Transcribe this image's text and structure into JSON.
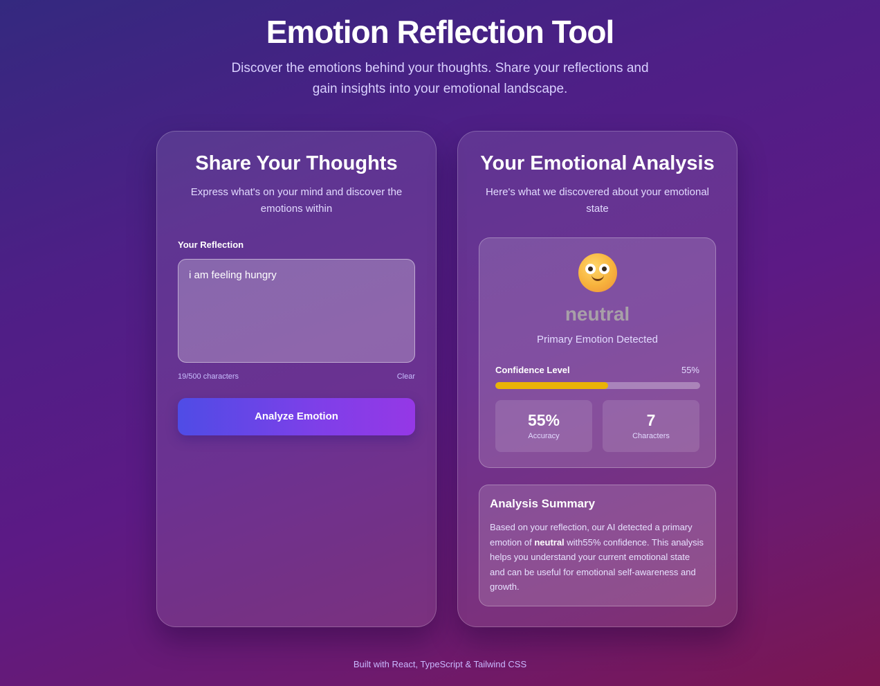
{
  "header": {
    "title": "Emotion Reflection Tool",
    "subtitle": "Discover the emotions behind your thoughts. Share your reflections and gain insights into your emotional landscape."
  },
  "input_card": {
    "title": "Share Your Thoughts",
    "subtitle": "Express what's on your mind and discover the emotions within",
    "field_label": "Your Reflection",
    "textarea_value": "i am feeling hungry",
    "char_counter": "19/500 characters",
    "clear_label": "Clear",
    "analyze_label": "Analyze Emotion"
  },
  "result_card": {
    "title": "Your Emotional Analysis",
    "subtitle": "Here's what we discovered about your emotional state",
    "emoji_icon": "neutral-face-icon",
    "emotion": "neutral",
    "emotion_caption": "Primary Emotion Detected",
    "confidence_label": "Confidence Level",
    "confidence_pct": "55%",
    "confidence_value": 0.55,
    "confidence_color": "#eab308",
    "stats": [
      {
        "value": "55%",
        "label": "Accuracy"
      },
      {
        "value": "7",
        "label": "Characters"
      }
    ],
    "summary": {
      "title": "Analysis Summary",
      "text_before": "Based on your reflection, our AI detected a primary emotion of ",
      "emotion_bold": "neutral",
      "text_after": " with55% confidence. This analysis helps you understand your current emotional state and can be useful for emotional self-awareness and growth."
    }
  },
  "footer": {
    "text": "Built with React, TypeScript & Tailwind CSS"
  }
}
